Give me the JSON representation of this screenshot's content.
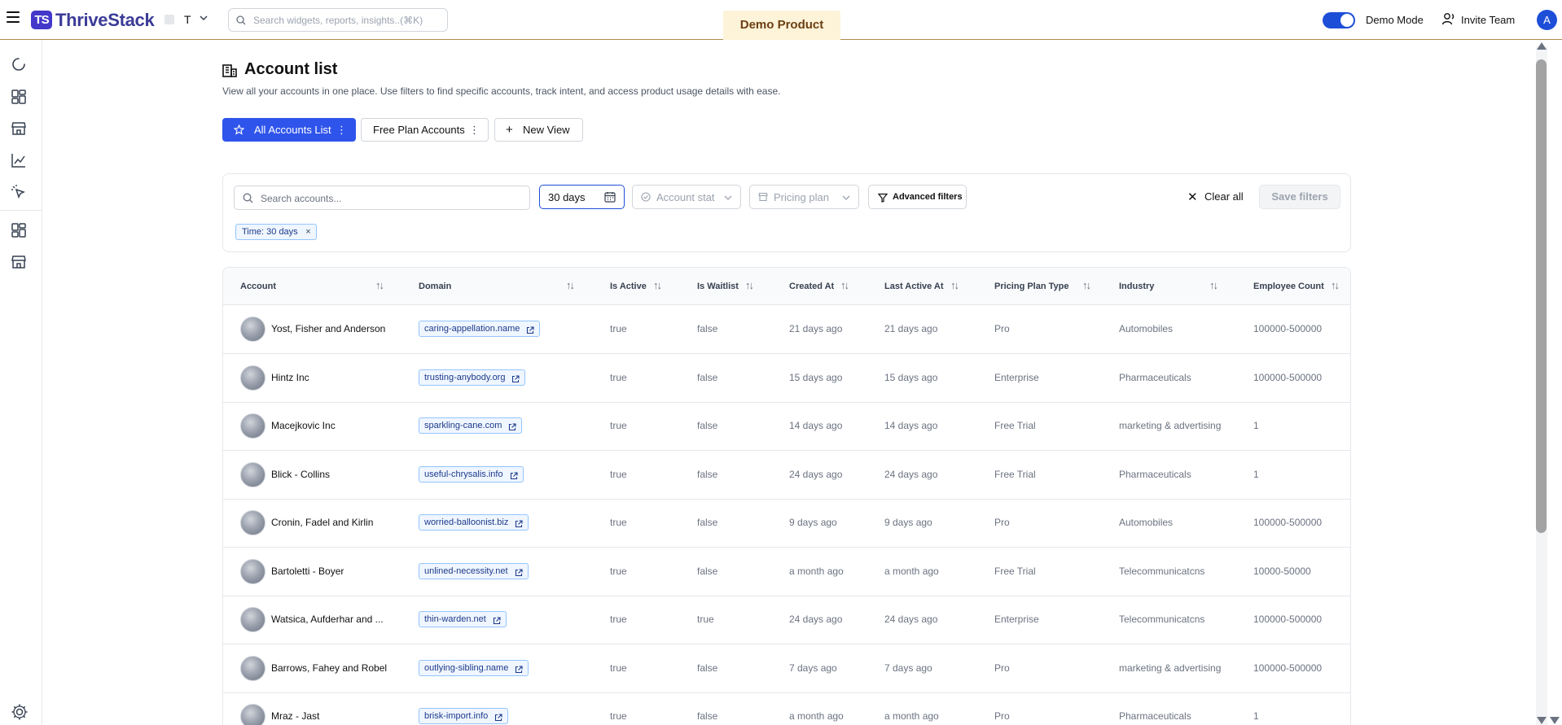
{
  "header": {
    "logo_mark": "TS",
    "logo_text": "ThriveStack",
    "workspace_initial": "T",
    "search_placeholder": "Search widgets, reports, insights..(⌘K)",
    "demo_badge": "Demo Product",
    "demo_mode_label": "Demo Mode",
    "demo_mode_on": true,
    "invite_label": "Invite Team",
    "avatar_initial": "A"
  },
  "sidebar": {
    "icons": [
      "loader-icon",
      "dashboard-grid-icon",
      "storefront-icon",
      "line-chart-icon",
      "cursor-click-icon",
      "dashboard-grid-icon",
      "storefront-icon",
      "settings-gear-icon"
    ]
  },
  "page": {
    "title": "Account list",
    "description": "View all your accounts in one place. Use filters to find specific accounts, track intent, and access product usage details with ease."
  },
  "views": [
    {
      "label": "All Accounts List",
      "active": true
    },
    {
      "label": "Free Plan Accounts",
      "active": false
    },
    {
      "label": "New View",
      "active": false
    }
  ],
  "filters": {
    "search_placeholder": "Search accounts...",
    "time_value": "30 days",
    "status_placeholder": "Account status",
    "pricing_placeholder": "Pricing plan",
    "advanced_label": "Advanced filters",
    "clear_label": "Clear all",
    "save_label": "Save filters",
    "chips": [
      "Time: 30 days"
    ]
  },
  "table": {
    "columns": [
      "Account",
      "Domain",
      "Is Active",
      "Is Waitlist",
      "Created At",
      "Last Active At",
      "Pricing Plan Type",
      "Industry",
      "Employee Count"
    ],
    "rows": [
      {
        "account": "Yost, Fisher and Anderson",
        "domain": "caring-appellation.name",
        "is_active": "true",
        "is_waitlist": "false",
        "created_at": "21 days ago",
        "last_active_at": "21 days ago",
        "plan": "Pro",
        "industry": "Automobiles",
        "employees": "100000-500000"
      },
      {
        "account": "Hintz Inc",
        "domain": "trusting-anybody.org",
        "is_active": "true",
        "is_waitlist": "false",
        "created_at": "15 days ago",
        "last_active_at": "15 days ago",
        "plan": "Enterprise",
        "industry": "Pharmaceuticals",
        "employees": "100000-500000"
      },
      {
        "account": "Macejkovic Inc",
        "domain": "sparkling-cane.com",
        "is_active": "true",
        "is_waitlist": "false",
        "created_at": "14 days ago",
        "last_active_at": "14 days ago",
        "plan": "Free Trial",
        "industry": "marketing & advertising",
        "employees": "1"
      },
      {
        "account": "Blick - Collins",
        "domain": "useful-chrysalis.info",
        "is_active": "true",
        "is_waitlist": "false",
        "created_at": "24 days ago",
        "last_active_at": "24 days ago",
        "plan": "Free Trial",
        "industry": "Pharmaceuticals",
        "employees": "1"
      },
      {
        "account": "Cronin, Fadel and Kirlin",
        "domain": "worried-balloonist.biz",
        "is_active": "true",
        "is_waitlist": "false",
        "created_at": "9 days ago",
        "last_active_at": "9 days ago",
        "plan": "Pro",
        "industry": "Automobiles",
        "employees": "100000-500000"
      },
      {
        "account": "Bartoletti - Boyer",
        "domain": "unlined-necessity.net",
        "is_active": "true",
        "is_waitlist": "false",
        "created_at": "a month ago",
        "last_active_at": "a month ago",
        "plan": "Free Trial",
        "industry": "Telecommunicatcns",
        "employees": "10000-50000"
      },
      {
        "account": "Watsica, Aufderhar and ...",
        "domain": "thin-warden.net",
        "is_active": "true",
        "is_waitlist": "true",
        "created_at": "24 days ago",
        "last_active_at": "24 days ago",
        "plan": "Enterprise",
        "industry": "Telecommunicatcns",
        "employees": "100000-500000"
      },
      {
        "account": "Barrows, Fahey and Robel",
        "domain": "outlying-sibling.name",
        "is_active": "true",
        "is_waitlist": "false",
        "created_at": "7 days ago",
        "last_active_at": "7 days ago",
        "plan": "Pro",
        "industry": "marketing & advertising",
        "employees": "100000-500000"
      },
      {
        "account": "Mraz - Jast",
        "domain": "brisk-import.info",
        "is_active": "true",
        "is_waitlist": "false",
        "created_at": "a month ago",
        "last_active_at": "a month ago",
        "plan": "Pro",
        "industry": "Pharmaceuticals",
        "employees": "1"
      }
    ]
  },
  "colors": {
    "primary": "#2f54eb",
    "logo": "#4338ca",
    "demo_badge_bg": "#fdf3d9",
    "chip_border": "#93c5fd"
  }
}
